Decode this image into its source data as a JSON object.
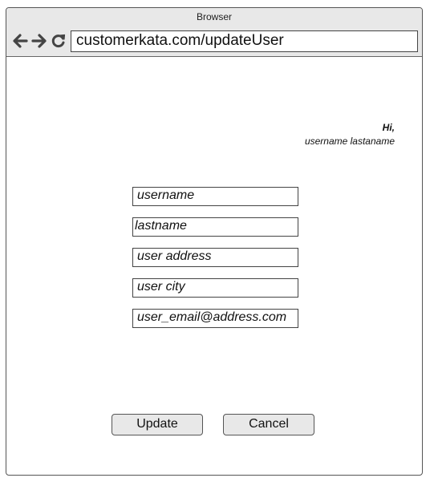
{
  "window": {
    "title": "Browser"
  },
  "address_bar": {
    "url": "customerkata.com/updateUser"
  },
  "greeting": {
    "hi": "Hi,",
    "user_name": "username lastaname"
  },
  "form": {
    "fields": [
      {
        "value": "username"
      },
      {
        "value": "lastname"
      },
      {
        "value": "user address"
      },
      {
        "value": "user city"
      },
      {
        "value": "user_email@address.com"
      }
    ]
  },
  "actions": {
    "update_label": "Update",
    "cancel_label": "Cancel"
  },
  "icons": {
    "back": "arrow-left-icon",
    "forward": "arrow-right-icon",
    "reload": "reload-icon"
  }
}
